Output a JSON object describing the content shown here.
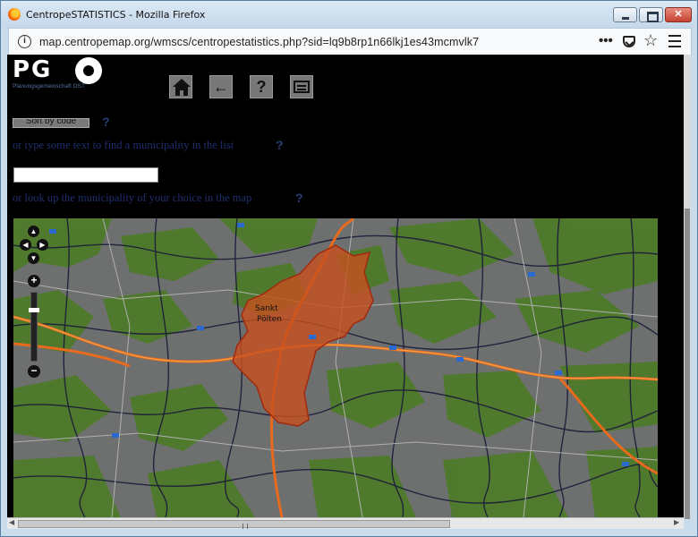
{
  "browser": {
    "window_title": "CentropeSTATISTICS - Mozilla Firefox",
    "url": "map.centropemap.org/wmscs/centropestatistics.php?sid=lq9b8rp1n66lkj1es43mcmvlk7",
    "close_glyph": "✕",
    "more_glyph": "•••",
    "star_glyph": "☆",
    "info_glyph": "i"
  },
  "header": {
    "logo_text": "PG",
    "logo_tagline": "Planungsgemeinschaft OST",
    "tools": [
      {
        "name": "home-icon",
        "glyph": ""
      },
      {
        "name": "back-arrow-icon",
        "glyph": "←"
      },
      {
        "name": "help-icon",
        "glyph": "?"
      },
      {
        "name": "panel-icon",
        "glyph": ""
      }
    ]
  },
  "controls": {
    "sort_button_label": "Sort by code",
    "help_mark": "?",
    "search_hint": "or type some text to find a municipality in the list",
    "search_value": "",
    "map_hint": "or look up the municipality of your choice in the map"
  },
  "map": {
    "highlight_color": "#c8501e",
    "highlight_label": "Sankt Pölten",
    "place_labels": [
      "Sankt",
      "Pölten"
    ],
    "pan_glyphs": {
      "up": "▲",
      "down": "▼",
      "left": "◀",
      "right": "▶"
    },
    "zoom_in_glyph": "+",
    "zoom_out_glyph": "−"
  },
  "colors": {
    "page_bg": "#000000",
    "hint_text": "#1f2f6e",
    "forest_green": "#4e7a2a",
    "road_orange": "#e86a1c",
    "highway_blue": "#2a6ad0"
  }
}
